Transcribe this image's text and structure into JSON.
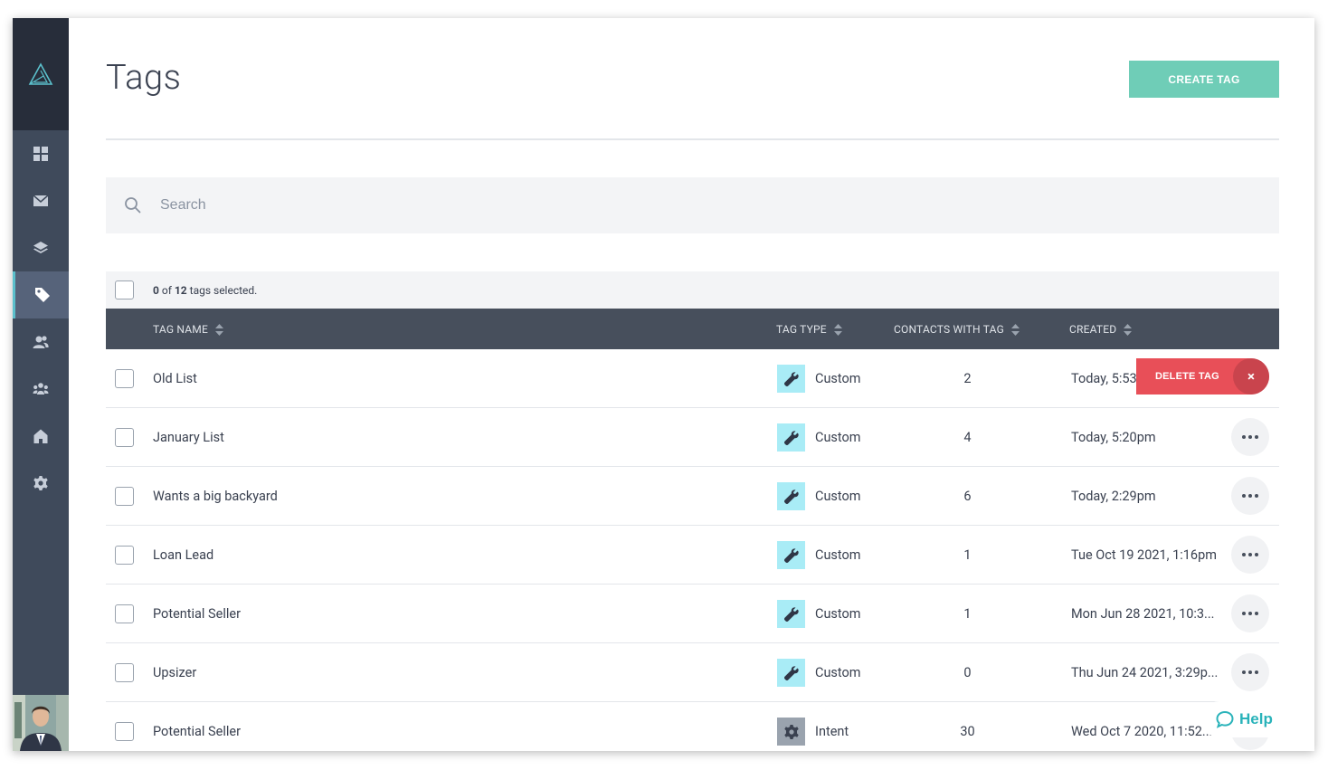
{
  "page": {
    "title": "Tags",
    "create_button": "CREATE TAG"
  },
  "search": {
    "placeholder": "Search",
    "value": ""
  },
  "selection": {
    "selected": "0",
    "of_text": "of",
    "total": "12",
    "suffix": "tags selected."
  },
  "columns": {
    "tag_name": "TAG NAME",
    "tag_type": "TAG TYPE",
    "contacts": "CONTACTS WITH TAG",
    "created": "CREATED"
  },
  "sidebar": {
    "items": [
      {
        "name": "dashboard",
        "icon": "grid-icon"
      },
      {
        "name": "mail",
        "icon": "envelope-icon"
      },
      {
        "name": "layers",
        "icon": "layers-icon"
      },
      {
        "name": "tags",
        "icon": "tag-icon",
        "active": true
      },
      {
        "name": "contacts",
        "icon": "users-icon"
      },
      {
        "name": "groups",
        "icon": "group-icon"
      },
      {
        "name": "home",
        "icon": "home-icon"
      },
      {
        "name": "settings",
        "icon": "gear-icon"
      }
    ]
  },
  "rows": [
    {
      "name": "Old List",
      "type": "Custom",
      "count": "2",
      "created": "Today, 5:53pm"
    },
    {
      "name": "January List",
      "type": "Custom",
      "count": "4",
      "created": "Today, 5:20pm"
    },
    {
      "name": "Wants a big backyard",
      "type": "Custom",
      "count": "6",
      "created": "Today, 2:29pm"
    },
    {
      "name": "Loan Lead",
      "type": "Custom",
      "count": "1",
      "created": "Tue Oct 19 2021, 1:16pm"
    },
    {
      "name": "Potential Seller",
      "type": "Custom",
      "count": "1",
      "created": "Mon Jun 28 2021, 10:3..."
    },
    {
      "name": "Upsizer",
      "type": "Custom",
      "count": "0",
      "created": "Thu Jun 24 2021, 3:29p..."
    },
    {
      "name": "Potential Seller",
      "type": "Intent",
      "count": "30",
      "created": "Wed Oct 7 2020, 11:52..."
    }
  ],
  "row_action": {
    "delete_label": "DELETE TAG",
    "close_symbol": "×"
  },
  "help": {
    "label": "Help"
  },
  "colors": {
    "accent": "#6fcdb7",
    "danger": "#e84f58",
    "sidebar": "#3f4a5b",
    "header": "#474f5c",
    "custom_badge": "#a9ecf6",
    "help": "#2ab3ba"
  }
}
